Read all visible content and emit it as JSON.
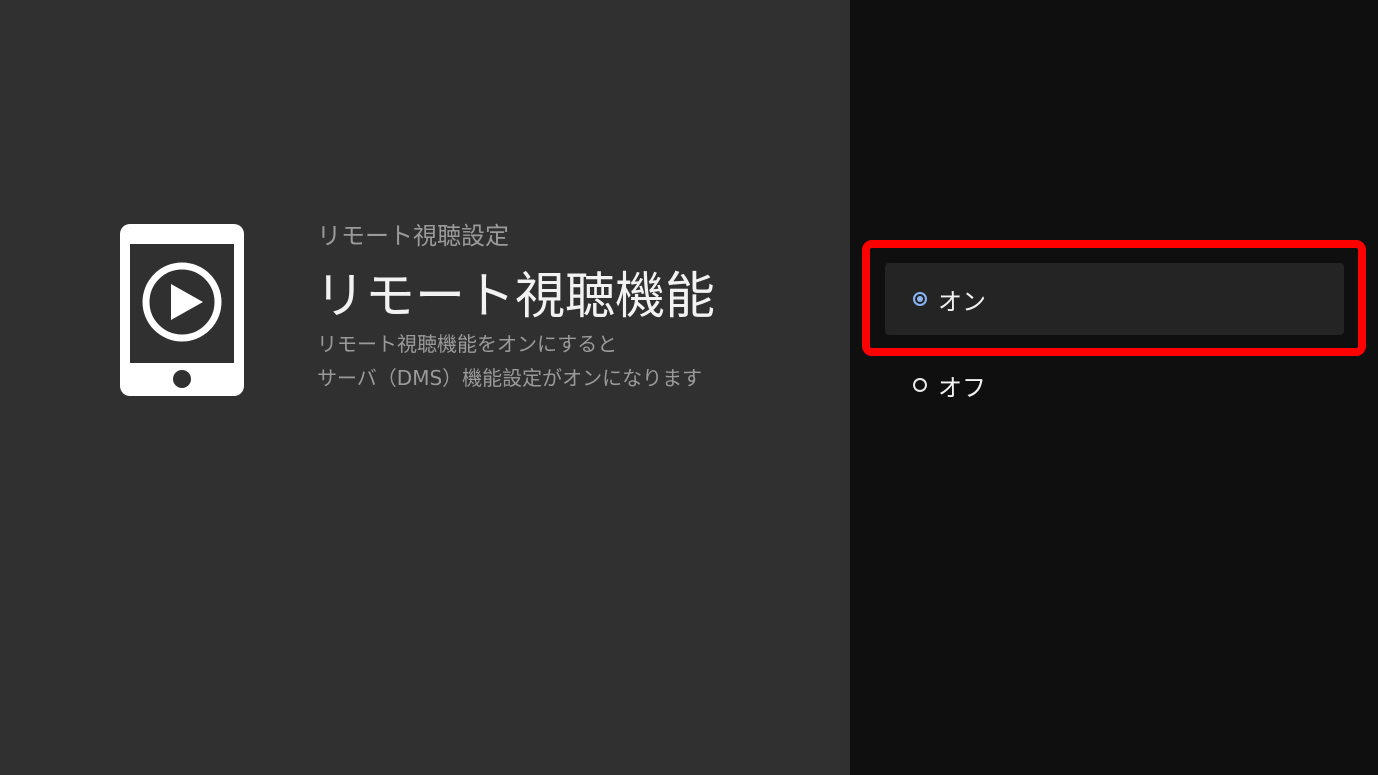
{
  "breadcrumb": "リモート視聴設定",
  "title": "リモート視聴機能",
  "description": {
    "line1": "リモート視聴機能をオンにすると",
    "line2": "サーバ（DMS）機能設定がオンになります"
  },
  "options": [
    {
      "label": "オン",
      "selected": true
    },
    {
      "label": "オフ",
      "selected": false
    }
  ],
  "icons": {
    "main": "phone-play-icon"
  },
  "colors": {
    "left_background": "#303030",
    "right_background": "#0f0f0f",
    "selected_radio": "#8ab4f8",
    "highlight_frame": "#ff0000"
  }
}
